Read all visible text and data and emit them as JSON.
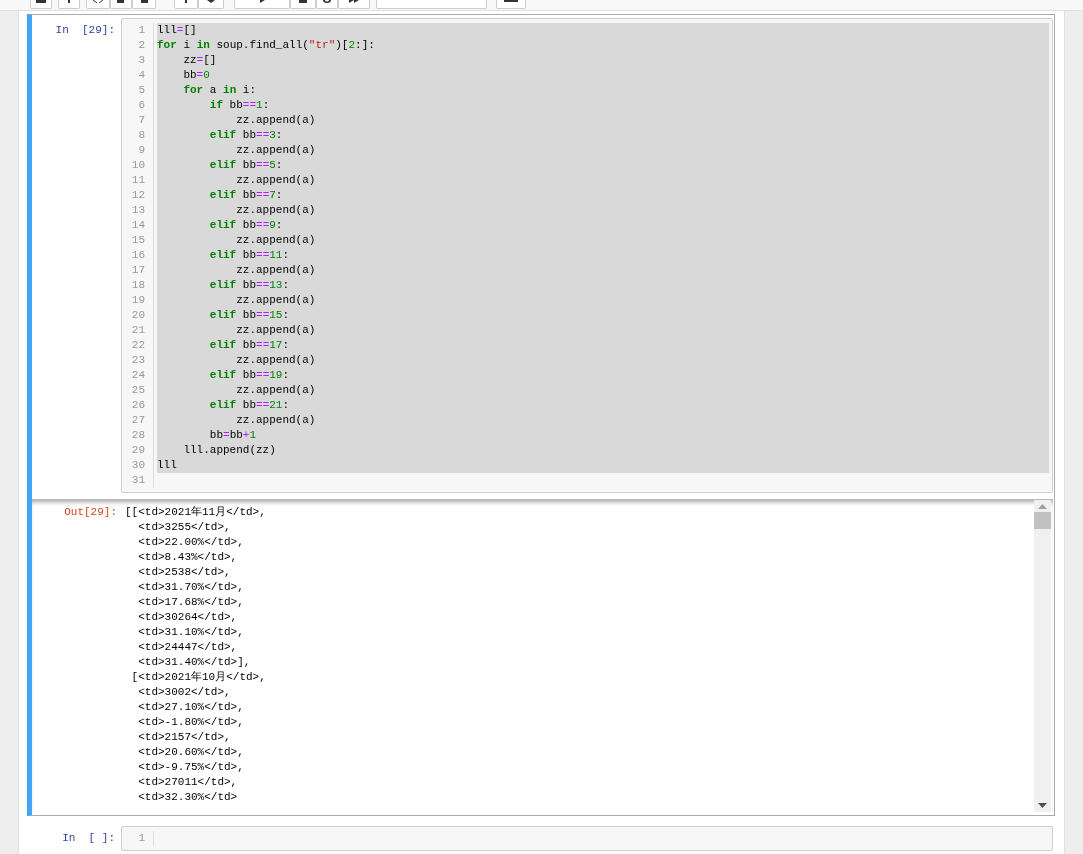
{
  "cells": [
    {
      "kind": "code",
      "prompt": "In  [29]:",
      "active": true,
      "lines": [
        {
          "no": "1",
          "selected": true,
          "tokens": [
            {
              "kind": "plain",
              "t": "lll"
            },
            {
              "kind": "op",
              "t": "="
            },
            {
              "kind": "plain",
              "t": "[]"
            }
          ]
        },
        {
          "no": "2",
          "selected": true,
          "tokens": [
            {
              "kind": "kw",
              "t": "for"
            },
            {
              "kind": "plain",
              "t": " i "
            },
            {
              "kind": "kw",
              "t": "in"
            },
            {
              "kind": "plain",
              "t": " soup.find_all("
            },
            {
              "kind": "str",
              "t": "\"tr\""
            },
            {
              "kind": "plain",
              "t": ")["
            },
            {
              "kind": "num",
              "t": "2"
            },
            {
              "kind": "plain",
              "t": ":]:"
            }
          ]
        },
        {
          "no": "3",
          "selected": true,
          "tokens": [
            {
              "kind": "plain",
              "t": "    zz"
            },
            {
              "kind": "op",
              "t": "="
            },
            {
              "kind": "plain",
              "t": "[]"
            }
          ]
        },
        {
          "no": "4",
          "selected": true,
          "tokens": [
            {
              "kind": "plain",
              "t": "    bb"
            },
            {
              "kind": "op",
              "t": "="
            },
            {
              "kind": "num",
              "t": "0"
            }
          ]
        },
        {
          "no": "5",
          "selected": true,
          "tokens": [
            {
              "kind": "kw",
              "t": "    for"
            },
            {
              "kind": "plain",
              "t": " a "
            },
            {
              "kind": "kw",
              "t": "in"
            },
            {
              "kind": "plain",
              "t": " i:"
            }
          ]
        },
        {
          "no": "6",
          "selected": true,
          "tokens": [
            {
              "kind": "kw",
              "t": "        if"
            },
            {
              "kind": "plain",
              "t": " bb"
            },
            {
              "kind": "op",
              "t": "=="
            },
            {
              "kind": "num",
              "t": "1"
            },
            {
              "kind": "plain",
              "t": ":"
            }
          ]
        },
        {
          "no": "7",
          "selected": true,
          "tokens": [
            {
              "kind": "plain",
              "t": "            zz.append(a)"
            }
          ]
        },
        {
          "no": "8",
          "selected": true,
          "tokens": [
            {
              "kind": "kw",
              "t": "        elif"
            },
            {
              "kind": "plain",
              "t": " bb"
            },
            {
              "kind": "op",
              "t": "=="
            },
            {
              "kind": "num",
              "t": "3"
            },
            {
              "kind": "plain",
              "t": ":"
            }
          ]
        },
        {
          "no": "9",
          "selected": true,
          "tokens": [
            {
              "kind": "plain",
              "t": "            zz.append(a)"
            }
          ]
        },
        {
          "no": "10",
          "selected": true,
          "tokens": [
            {
              "kind": "kw",
              "t": "        elif"
            },
            {
              "kind": "plain",
              "t": " bb"
            },
            {
              "kind": "op",
              "t": "=="
            },
            {
              "kind": "num",
              "t": "5"
            },
            {
              "kind": "plain",
              "t": ":"
            }
          ]
        },
        {
          "no": "11",
          "selected": true,
          "tokens": [
            {
              "kind": "plain",
              "t": "            zz.append(a)"
            }
          ]
        },
        {
          "no": "12",
          "selected": true,
          "tokens": [
            {
              "kind": "kw",
              "t": "        elif"
            },
            {
              "kind": "plain",
              "t": " bb"
            },
            {
              "kind": "op",
              "t": "=="
            },
            {
              "kind": "num",
              "t": "7"
            },
            {
              "kind": "plain",
              "t": ":"
            }
          ]
        },
        {
          "no": "13",
          "selected": true,
          "tokens": [
            {
              "kind": "plain",
              "t": "            zz.append(a)"
            }
          ]
        },
        {
          "no": "14",
          "selected": true,
          "tokens": [
            {
              "kind": "kw",
              "t": "        elif"
            },
            {
              "kind": "plain",
              "t": " bb"
            },
            {
              "kind": "op",
              "t": "=="
            },
            {
              "kind": "num",
              "t": "9"
            },
            {
              "kind": "plain",
              "t": ":"
            }
          ]
        },
        {
          "no": "15",
          "selected": true,
          "tokens": [
            {
              "kind": "plain",
              "t": "            zz.append(a)"
            }
          ]
        },
        {
          "no": "16",
          "selected": true,
          "tokens": [
            {
              "kind": "kw",
              "t": "        elif"
            },
            {
              "kind": "plain",
              "t": " bb"
            },
            {
              "kind": "op",
              "t": "=="
            },
            {
              "kind": "num",
              "t": "11"
            },
            {
              "kind": "plain",
              "t": ":"
            }
          ]
        },
        {
          "no": "17",
          "selected": true,
          "tokens": [
            {
              "kind": "plain",
              "t": "            zz.append(a)"
            }
          ]
        },
        {
          "no": "18",
          "selected": true,
          "tokens": [
            {
              "kind": "kw",
              "t": "        elif"
            },
            {
              "kind": "plain",
              "t": " bb"
            },
            {
              "kind": "op",
              "t": "=="
            },
            {
              "kind": "num",
              "t": "13"
            },
            {
              "kind": "plain",
              "t": ":"
            }
          ]
        },
        {
          "no": "19",
          "selected": true,
          "tokens": [
            {
              "kind": "plain",
              "t": "            zz.append(a)"
            }
          ]
        },
        {
          "no": "20",
          "selected": true,
          "tokens": [
            {
              "kind": "kw",
              "t": "        elif"
            },
            {
              "kind": "plain",
              "t": " bb"
            },
            {
              "kind": "op",
              "t": "=="
            },
            {
              "kind": "num",
              "t": "15"
            },
            {
              "kind": "plain",
              "t": ":"
            }
          ]
        },
        {
          "no": "21",
          "selected": true,
          "tokens": [
            {
              "kind": "plain",
              "t": "            zz.append(a)"
            }
          ]
        },
        {
          "no": "22",
          "selected": true,
          "tokens": [
            {
              "kind": "kw",
              "t": "        elif"
            },
            {
              "kind": "plain",
              "t": " bb"
            },
            {
              "kind": "op",
              "t": "=="
            },
            {
              "kind": "num",
              "t": "17"
            },
            {
              "kind": "plain",
              "t": ":"
            }
          ]
        },
        {
          "no": "23",
          "selected": true,
          "tokens": [
            {
              "kind": "plain",
              "t": "            zz.append(a)"
            }
          ]
        },
        {
          "no": "24",
          "selected": true,
          "tokens": [
            {
              "kind": "kw",
              "t": "        elif"
            },
            {
              "kind": "plain",
              "t": " bb"
            },
            {
              "kind": "op",
              "t": "=="
            },
            {
              "kind": "num",
              "t": "19"
            },
            {
              "kind": "plain",
              "t": ":"
            }
          ]
        },
        {
          "no": "25",
          "selected": true,
          "tokens": [
            {
              "kind": "plain",
              "t": "            zz.append(a)"
            }
          ]
        },
        {
          "no": "26",
          "selected": true,
          "tokens": [
            {
              "kind": "kw",
              "t": "        elif"
            },
            {
              "kind": "plain",
              "t": " bb"
            },
            {
              "kind": "op",
              "t": "=="
            },
            {
              "kind": "num",
              "t": "21"
            },
            {
              "kind": "plain",
              "t": ":"
            }
          ]
        },
        {
          "no": "27",
          "selected": true,
          "tokens": [
            {
              "kind": "plain",
              "t": "            zz.append(a)"
            }
          ]
        },
        {
          "no": "28",
          "selected": true,
          "tokens": [
            {
              "kind": "plain",
              "t": "        bb"
            },
            {
              "kind": "op",
              "t": "="
            },
            {
              "kind": "plain",
              "t": "bb"
            },
            {
              "kind": "op",
              "t": "+"
            },
            {
              "kind": "num",
              "t": "1"
            }
          ]
        },
        {
          "no": "29",
          "selected": true,
          "tokens": [
            {
              "kind": "plain",
              "t": "    lll.append(zz)"
            }
          ]
        },
        {
          "no": "30",
          "selected": true,
          "tokens": [
            {
              "kind": "plain",
              "t": "lll"
            }
          ]
        },
        {
          "no": "31",
          "selected": false
        }
      ],
      "output": {
        "prompt": "Out[29]:",
        "lines": [
          "[[<td>2021年11月</td>,",
          "  <td>3255</td>,",
          "  <td>22.00%</td>,",
          "  <td>8.43%</td>,",
          "  <td>2538</td>,",
          "  <td>31.70%</td>,",
          "  <td>17.68%</td>,",
          "  <td>30264</td>,",
          "  <td>31.10%</td>,",
          "  <td>24447</td>,",
          "  <td>31.40%</td>],",
          " [<td>2021年10月</td>,",
          "  <td>3002</td>,",
          "  <td>27.10%</td>,",
          "  <td>-1.80%</td>,",
          "  <td>2157</td>,",
          "  <td>20.60%</td>,",
          "  <td>-9.75%</td>,",
          "  <td>27011</td>,",
          "  <td>32.30%</td>"
        ]
      }
    },
    {
      "kind": "code",
      "prompt": "In  [ ]:",
      "active": false,
      "lines": [
        {
          "no": "1",
          "selected": false
        }
      ]
    }
  ]
}
